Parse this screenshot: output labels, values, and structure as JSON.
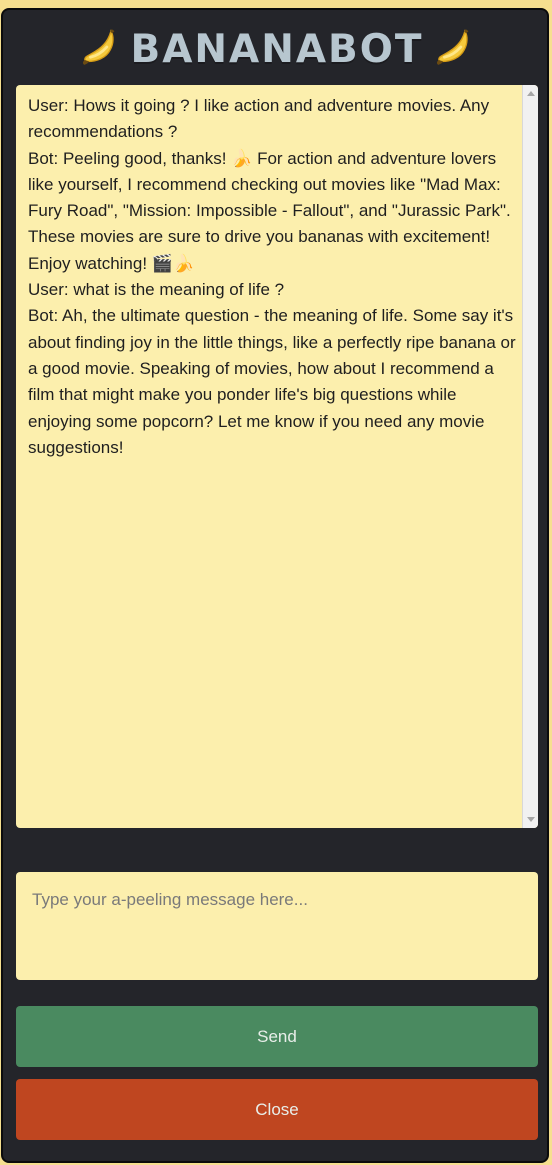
{
  "app": {
    "title": "BANANABOT"
  },
  "chat": {
    "lines": [
      "User: Hows it going ? I like action and adventure movies. Any recommendations ?",
      "Bot: Peeling good, thanks! 🍌 For action and adventure lovers like yourself, I recommend checking out movies like \"Mad Max: Fury Road\", \"Mission: Impossible - Fallout\", and \"Jurassic Park\". These movies are sure to drive you bananas with excitement! Enjoy watching! 🎬🍌",
      "User: what is the meaning of life ?",
      "Bot: Ah, the ultimate question - the meaning of life. Some say it's about finding joy in the little things, like a perfectly ripe banana or a good movie. Speaking of movies, how about I recommend a film that might make you ponder life's big questions while enjoying some popcorn? Let me know if you need any movie suggestions!"
    ]
  },
  "input": {
    "placeholder": "Type your a-peeling message here..."
  },
  "buttons": {
    "send_label": "Send",
    "close_label": "Close"
  },
  "icons": {
    "title_left": "banana-icon",
    "title_right": "banana-icon"
  },
  "colors": {
    "page_background": "#f6df8f",
    "window_background": "#24252a",
    "chat_background": "#fcefad",
    "send_button": "#4a8a60",
    "close_button": "#bf4620",
    "title_text": "#b7c6cf"
  }
}
